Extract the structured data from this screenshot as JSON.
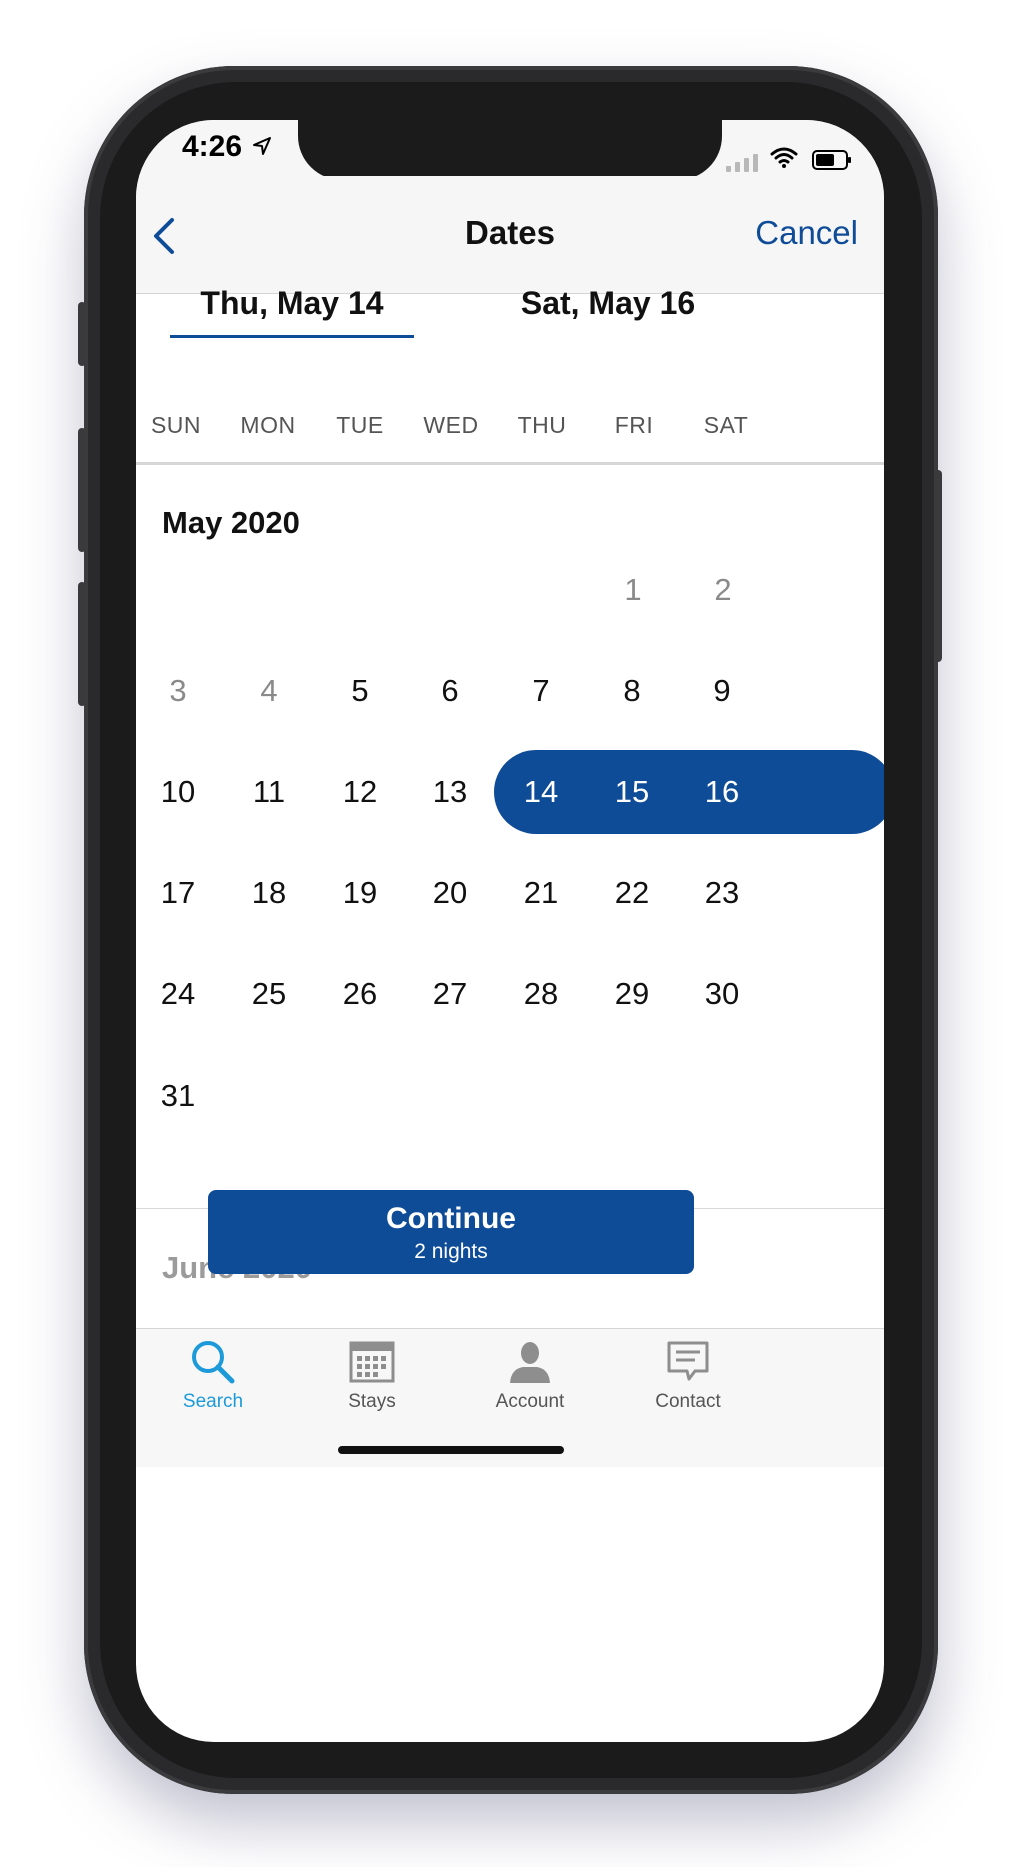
{
  "status": {
    "time": "4:26"
  },
  "nav": {
    "title": "Dates",
    "cancel_label": "Cancel"
  },
  "dates": {
    "check_in": "Thu, May 14",
    "check_out": "Sat, May 16"
  },
  "weekdays": [
    "SUN",
    "MON",
    "TUE",
    "WED",
    "THU",
    "FRI",
    "SAT"
  ],
  "calendar": {
    "month": "May 2020",
    "days": [
      "1",
      "2",
      "3",
      "4",
      "5",
      "6",
      "7",
      "8",
      "9",
      "10",
      "11",
      "12",
      "13",
      "14",
      "15",
      "16",
      "17",
      "18",
      "19",
      "20",
      "21",
      "22",
      "23",
      "24",
      "25",
      "26",
      "27",
      "28",
      "29",
      "30",
      "31"
    ],
    "selected_range": [
      "14",
      "15",
      "16"
    ],
    "past_days": [
      "1",
      "2",
      "3",
      "4"
    ],
    "next_month": "June 2020"
  },
  "continue": {
    "label": "Continue",
    "sub_label": "2 nights"
  },
  "tabs": [
    {
      "label": "Search",
      "icon": "search-icon"
    },
    {
      "label": "Stays",
      "icon": "calendar-icon"
    },
    {
      "label": "Account",
      "icon": "person-icon"
    },
    {
      "label": "Contact",
      "icon": "chat-icon"
    }
  ],
  "colors": {
    "accent": "#0f4c97",
    "tab_active": "#1d9ad9",
    "muted": "#8a8a8a"
  }
}
